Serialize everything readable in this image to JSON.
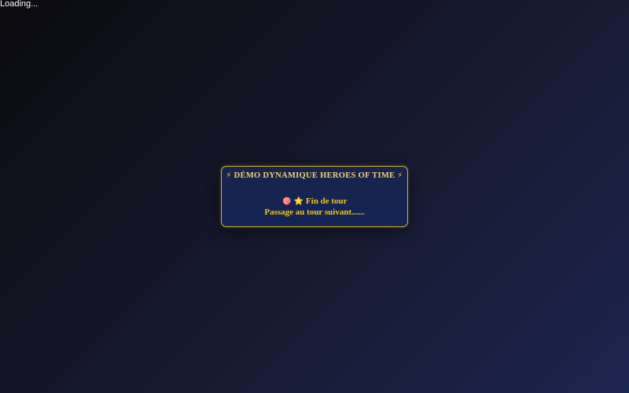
{
  "page": {
    "loading_text": "Loading..."
  },
  "dialog": {
    "title_bolt_left": "⚡",
    "title": "DÉMO DYNAMIQUE HEROES OF TIME",
    "title_bolt_right": "⚡",
    "line1_icon_target": "🎯",
    "line1_icon_star": "⭐",
    "line1_text": "Fin de tour",
    "line2_text": "Passage au tour suivant......"
  },
  "colors": {
    "accent_gold": "#f5c518",
    "dialog_border": "#d9b52a",
    "dialog_bg": "#132456"
  },
  "icons": {
    "title_icon": "lightning-bolt-icon",
    "line1_icons": [
      "target-icon",
      "star-icon"
    ]
  }
}
